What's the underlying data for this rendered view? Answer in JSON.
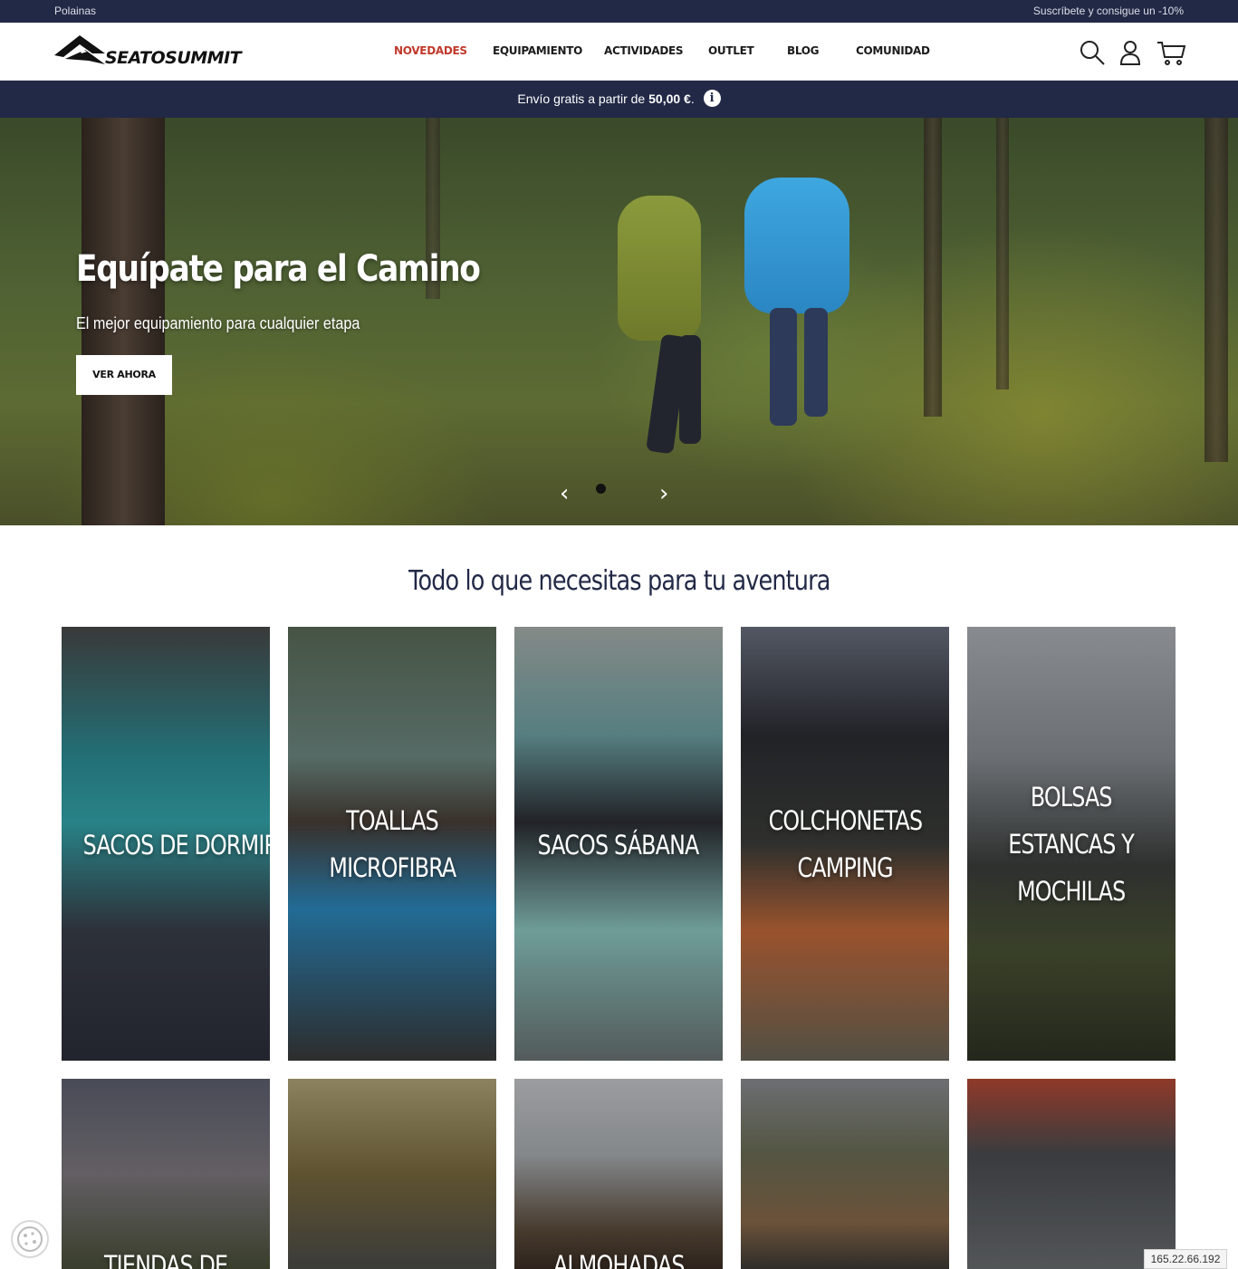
{
  "topbar": {
    "left_text": "Polainas",
    "right_text": "Suscríbete y consigue un -10%"
  },
  "header": {
    "logo_text": "SEATOSUMMIT",
    "nav": [
      "NOVEDADES",
      "EQUIPAMIENTO",
      "ACTIVIDADES",
      "OUTLET",
      "BLOG",
      "COMUNIDAD"
    ],
    "active_nav": "NOVEDADES",
    "icons": [
      "search-icon",
      "account-icon",
      "cart-icon"
    ]
  },
  "shipping": {
    "text_before": "Envío gratis a partir de",
    "amount": "50,00 €",
    "text_after": ".",
    "info_glyph": "i"
  },
  "hero": {
    "title": "Equípate para el Camino",
    "subtitle": "El mejor equipamiento para cualquier etapa",
    "button": "VER AHORA",
    "prev_glyph": "‹",
    "next_glyph": "›"
  },
  "section": {
    "title": "Todo lo que necesitas para tu aventura"
  },
  "categories": [
    {
      "lines": [
        "SACOS DE DORMIR"
      ]
    },
    {
      "lines": [
        "TOALLAS",
        "MICROFIBRA"
      ]
    },
    {
      "lines": [
        "SACOS SÁBANA"
      ]
    },
    {
      "lines": [
        "COLCHONETAS",
        "CAMPING"
      ]
    },
    {
      "lines": [
        "BOLSAS",
        "ESTANCAS Y",
        "MOCHILAS"
      ]
    },
    {
      "lines": [
        "TIENDAS DE"
      ]
    },
    {
      "lines": []
    },
    {
      "lines": [
        "ALMOHADAS"
      ]
    },
    {
      "lines": []
    },
    {
      "lines": []
    }
  ],
  "overlay": {
    "ip": "165.22.66.192"
  },
  "colors": {
    "navy": "#222946",
    "accent": "#c0392b"
  }
}
